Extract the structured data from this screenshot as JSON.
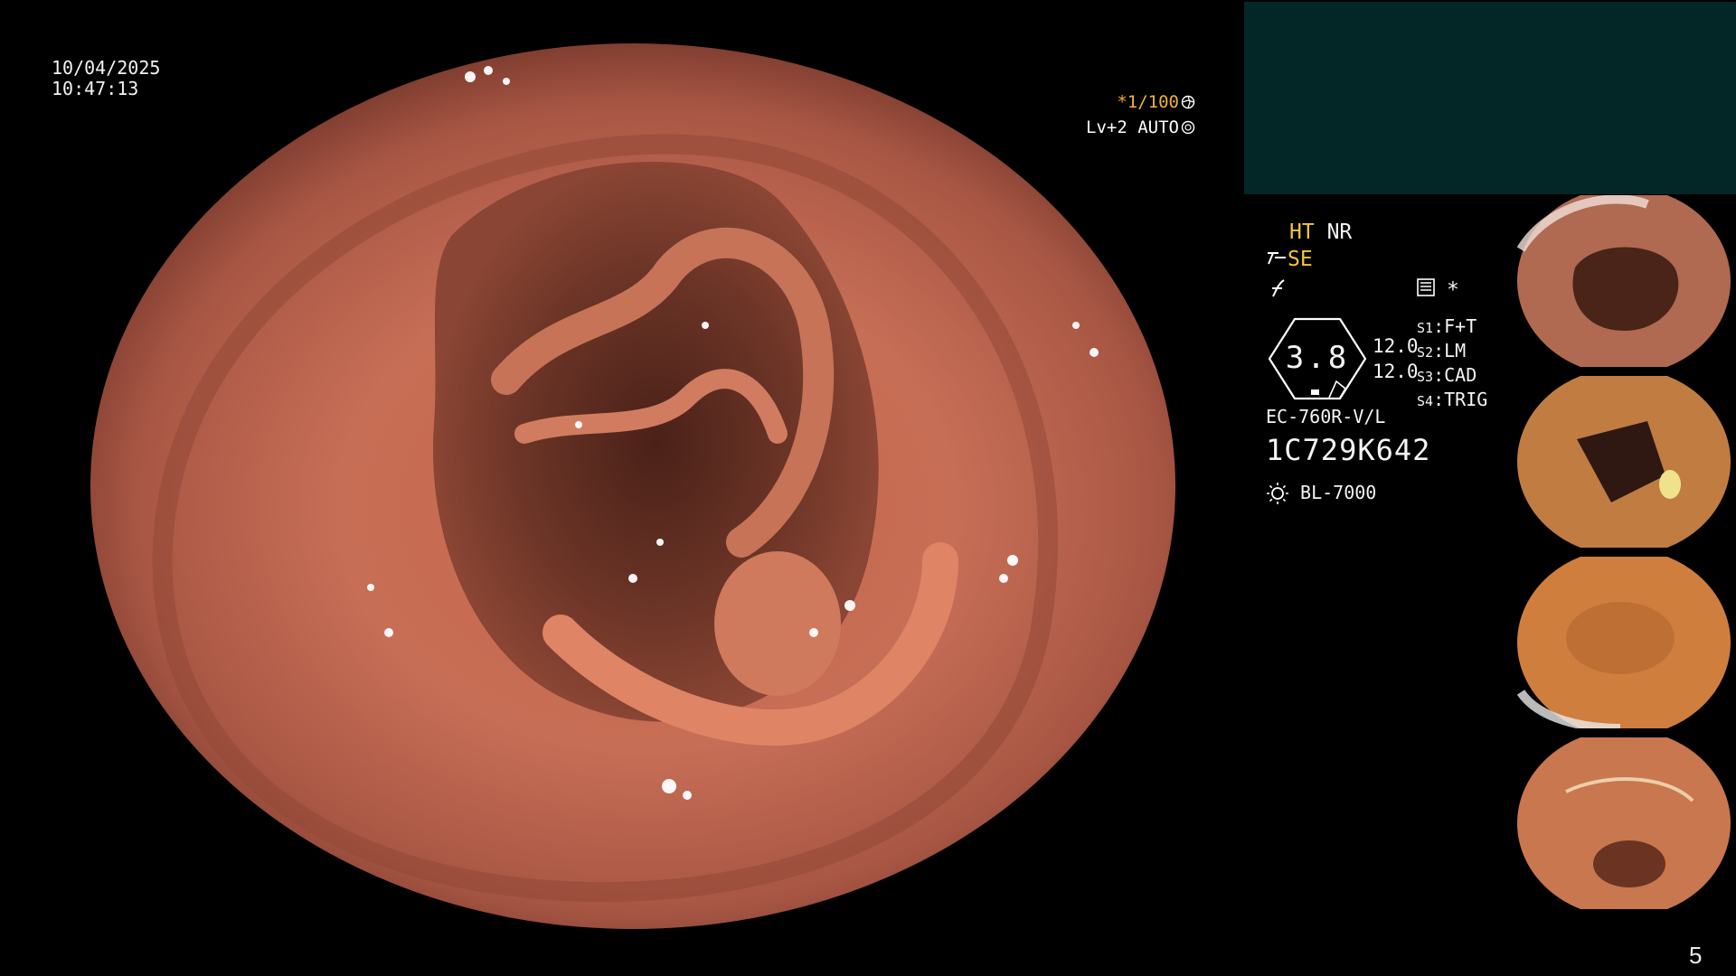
{
  "osd": {
    "date": "10/04/2025",
    "time": "10:47:13",
    "shutter": "*1/100",
    "level": "Lv+2 AUTO",
    "shutter_icon": "aperture-icon",
    "auto_icon": "iris-icon"
  },
  "status": {
    "ht": "HT",
    "nr": "NR",
    "se": "SE",
    "se_icon": "structure-enhance-icon",
    "color_icon": "color-mode-icon",
    "memory_icon": "memory-card-icon",
    "asterisk": "*"
  },
  "gauge": {
    "value": "3.8",
    "right_top": "12.0",
    "right_bottom": "12.0"
  },
  "switches": [
    {
      "key": "S1",
      "value": "F+T"
    },
    {
      "key": "S2",
      "value": "LM"
    },
    {
      "key": "S3",
      "value": "CAD"
    },
    {
      "key": "S4",
      "value": "TRIG"
    }
  ],
  "scope": {
    "model": "EC-760R-V/L",
    "serial": "1C729K642",
    "light_source": "BL-7000",
    "light_icon": "light-source-icon"
  },
  "page_number": "5",
  "colors": {
    "panel_teal": "#032727",
    "accent_yellow": "#f6c53a",
    "tissue": "#c56a50"
  }
}
